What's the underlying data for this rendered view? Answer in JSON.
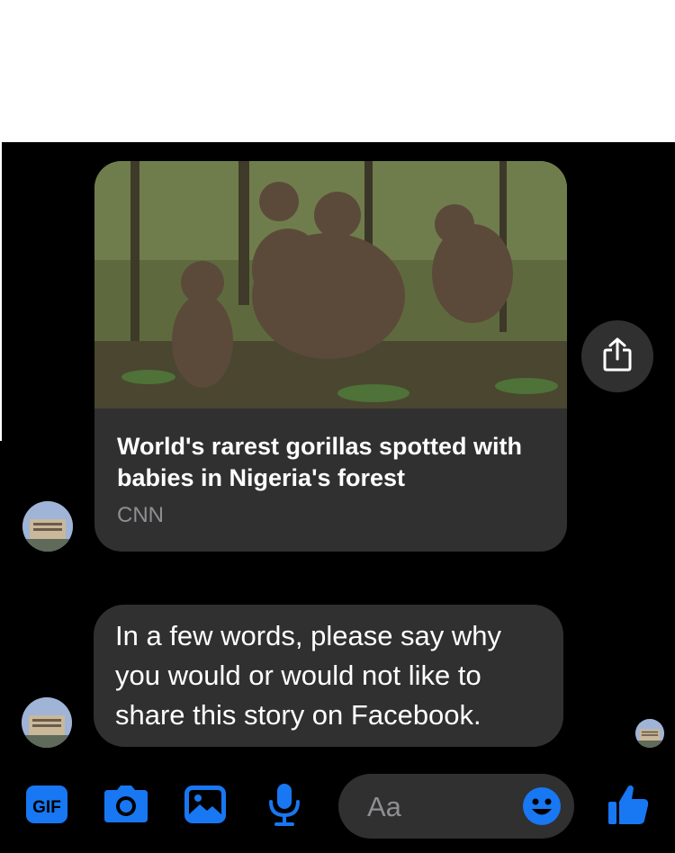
{
  "link_card": {
    "title": "World's rarest gorillas spotted with babies in Nigeria's forest",
    "source": "CNN",
    "image": "gorillas-in-forest-photo"
  },
  "message": {
    "text": "In a few words, please say why you would or would not like to share this story on Facebook."
  },
  "composer": {
    "placeholder": "Aa",
    "icons": [
      "gif-icon",
      "camera-icon",
      "image-icon",
      "microphone-icon",
      "emoji-icon",
      "thumbs-up-icon"
    ]
  },
  "colors": {
    "accent": "#1877f2",
    "bubble": "#303030",
    "background": "#000000",
    "secondary_text": "#8e8e93"
  }
}
